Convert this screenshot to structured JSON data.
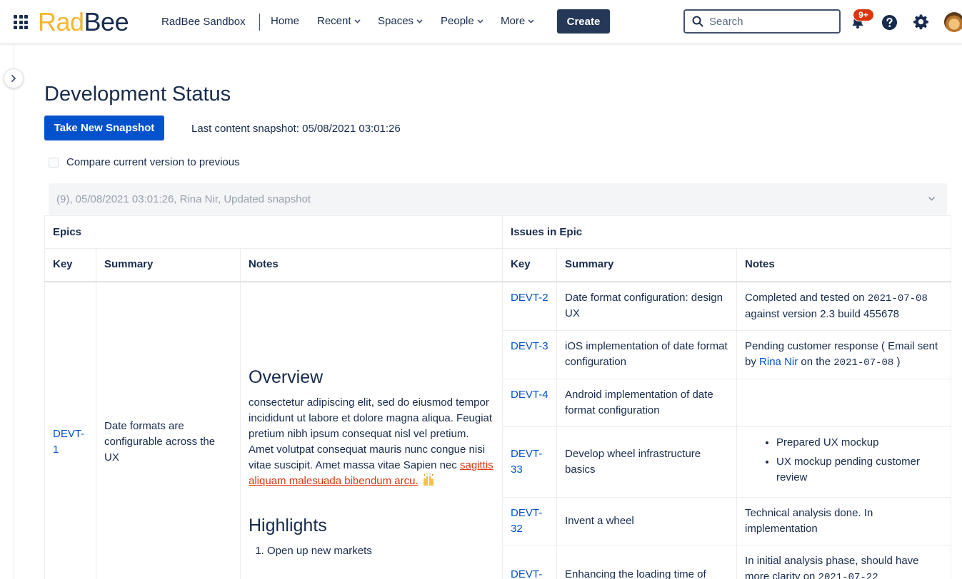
{
  "header": {
    "logo_a": "Rad",
    "logo_b": "Bee",
    "site_name": "RadBee Sandbox",
    "nav": [
      {
        "label": "Home"
      },
      {
        "label": "Recent"
      },
      {
        "label": "Spaces"
      },
      {
        "label": "People"
      },
      {
        "label": "More"
      }
    ],
    "create_label": "Create",
    "search_placeholder": "Search",
    "notifications_badge": "9+",
    "icons": [
      "app-switcher-icon",
      "bell-icon",
      "help-icon",
      "gear-icon",
      "search-icon"
    ]
  },
  "page": {
    "title": "Development Status",
    "snapshot_button": "Take New Snapshot",
    "snapshot_info": "Last content snapshot: 05/08/2021 03:01:26",
    "compare_label": "Compare current version to previous",
    "version_selected": "(9), 05/08/2021 03:01:26, Rina Nir, Updated snapshot"
  },
  "table": {
    "group_headers": {
      "epics": "Epics",
      "issues": "Issues in Epic"
    },
    "columns": {
      "key": "Key",
      "summary": "Summary",
      "notes": "Notes"
    },
    "epic": {
      "key": "DEVT-1",
      "summary": "Date formats are configurable across the UX",
      "overview_heading": "Overview",
      "overview_text": "consectetur adipiscing elit, sed do eiusmod tempor incididunt ut labore et dolore magna aliqua. Feugiat pretium nibh ipsum consequat nisl vel pretium. Amet volutpat consequat mauris nunc congue nisi vitae suscipit. Amet massa vitae Sapien nec ",
      "overview_link": "sagittis aliquam malesuada bibendum arcu.",
      "highlights_heading": "Highlights",
      "highlights": [
        "Open up new markets"
      ]
    },
    "issues": [
      {
        "key": "DEVT-2",
        "summary": "Date format configuration: design UX",
        "notes_pre": "Completed and tested on ",
        "notes_code": "2021-07-08",
        "notes_post": " against version 2.3 build 455678"
      },
      {
        "key": "DEVT-3",
        "summary": "iOS implementation of date format configuration",
        "notes_pre": "Pending customer response ( Email sent by ",
        "notes_link": "Rina Nir",
        "notes_mid": " on the ",
        "notes_code": "2021-07-08",
        "notes_post": " )"
      },
      {
        "key": "DEVT-4",
        "summary": "Android implementation of date format configuration"
      },
      {
        "key": "DEVT-33",
        "summary": "Develop wheel infrastructure basics",
        "notes_bullets": [
          "Prepared UX mockup",
          "UX mockup pending customer review"
        ]
      },
      {
        "key": "DEVT-32",
        "summary": "Invent a wheel",
        "notes_pre": "Technical analysis done. In implementation"
      },
      {
        "key": "DEVT-",
        "summary": "Enhancing the loading time of",
        "notes_pre": "In initial analysis phase, should have more clarity on ",
        "notes_code": "2021-07-22"
      }
    ]
  }
}
